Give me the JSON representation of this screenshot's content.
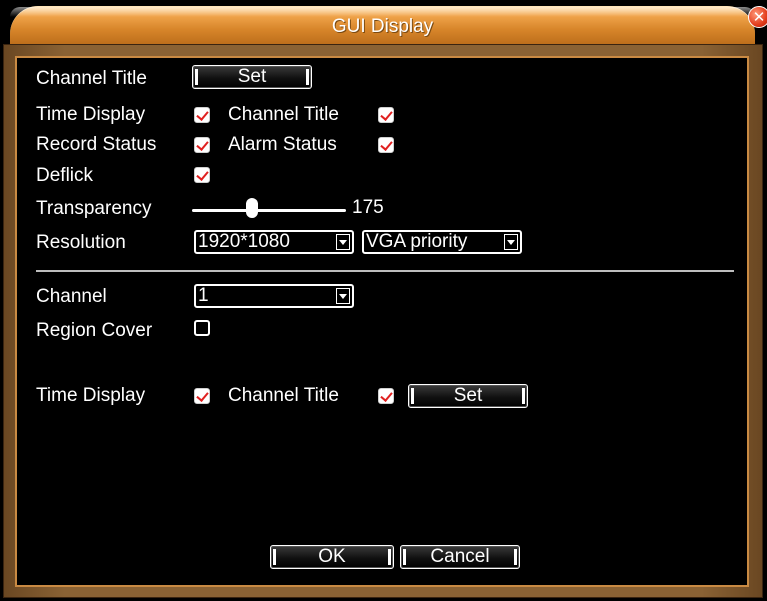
{
  "window": {
    "title": "GUI Display",
    "close_icon": "close-icon"
  },
  "colors": {
    "title_bar": "#d8862b",
    "frame": "#8a6234",
    "panel_border": "#c98a43",
    "checkmark": "#e02020"
  },
  "top_section": {
    "channel_title_label": "Channel Title",
    "set_button": "Set",
    "time_display_label": "Time Display",
    "time_display_checked": true,
    "channel_title_check_label": "Channel Title",
    "channel_title_checked": true,
    "record_status_label": "Record Status",
    "record_status_checked": true,
    "alarm_status_label": "Alarm Status",
    "alarm_status_checked": true,
    "deflick_label": "Deflick",
    "deflick_checked": true,
    "transparency_label": "Transparency",
    "transparency_value": "175",
    "resolution_label": "Resolution",
    "resolution_value": "1920*1080",
    "output_priority_value": "VGA priority"
  },
  "bottom_section": {
    "channel_label": "Channel",
    "channel_value": "1",
    "region_cover_label": "Region Cover",
    "region_cover_checked": false,
    "time_display_label": "Time Display",
    "time_display_checked": true,
    "channel_title_label": "Channel Title",
    "channel_title_checked": true,
    "set_button": "Set"
  },
  "footer": {
    "ok_button": "OK",
    "cancel_button": "Cancel"
  }
}
